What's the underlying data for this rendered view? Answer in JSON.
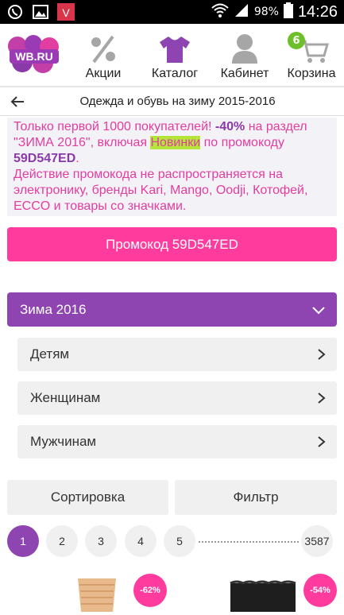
{
  "status_bar": {
    "battery": "98%",
    "time": "14:26",
    "icons": [
      "viber-icon",
      "gallery-icon",
      "app-v-icon",
      "wifi-icon",
      "signal-icon",
      "battery-icon"
    ]
  },
  "header": {
    "logo": "WB.RU",
    "nav": [
      {
        "label": "Акции",
        "icon": "percent-icon"
      },
      {
        "label": "Каталог",
        "icon": "tshirt-icon"
      },
      {
        "label": "Кабинет",
        "icon": "user-icon"
      },
      {
        "label": "Корзина",
        "icon": "cart-icon",
        "badge": "6"
      }
    ]
  },
  "title_bar": {
    "title": "Одежда и обувь на зиму 2015-2016"
  },
  "promo": {
    "part1": "Только первой 1000 покупателей! ",
    "discount": "-40%",
    "part2": " на раздел \"ЗИМА 2016\", включая ",
    "highlight": "Новинки",
    "part3": " по промокоду ",
    "code": "59D547ED",
    "part4": ".",
    "note": "Действие промокода не распространяется на электронику, бренды Kari, Mango, Oodji, Котофей, ECCO и товары со значками."
  },
  "promo_button": "Промокод 59D547ED",
  "season": {
    "label": "Зима 2016"
  },
  "subcategories": [
    "Детям",
    "Женщинам",
    "Мужчинам"
  ],
  "controls": {
    "sort": "Сортировка",
    "filter": "Фильтр"
  },
  "pagination": {
    "pages": [
      "1",
      "2",
      "3",
      "4",
      "5"
    ],
    "last": "3587",
    "active": "1"
  },
  "products": [
    {
      "discount": "-62%"
    },
    {
      "discount": "-54%"
    }
  ],
  "colors": {
    "brand_purple": "#8e45b1",
    "brand_pink": "#ff3c9e",
    "badge_green": "#6ec02a",
    "highlight_green": "#b5e43a"
  }
}
